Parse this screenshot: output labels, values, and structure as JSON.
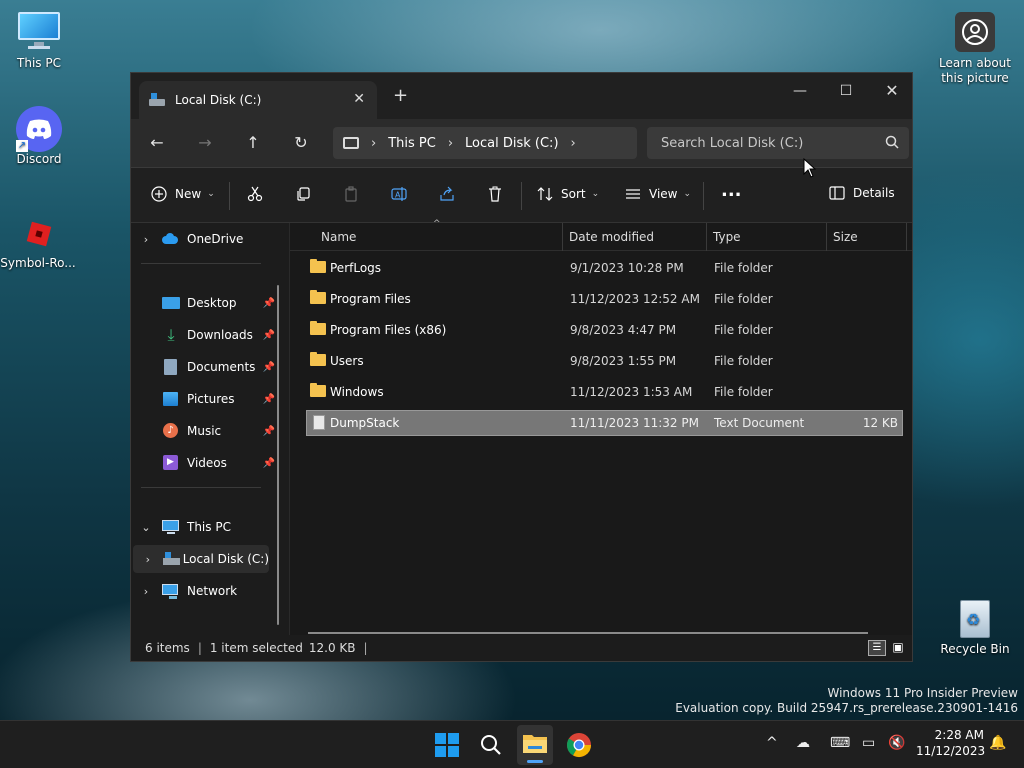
{
  "desktop": {
    "icons": [
      {
        "label": "This PC"
      },
      {
        "label": "Discord"
      },
      {
        "label": "Symbol-Ro..."
      },
      {
        "label": "Learn about this picture"
      },
      {
        "label": "Recycle Bin"
      }
    ],
    "watermark_line1": "Windows 11 Pro Insider Preview",
    "watermark_line2": "Evaluation copy. Build 25947.rs_prerelease.230901-1416"
  },
  "window": {
    "tab_title": "Local Disk (C:)",
    "new_tab": "+",
    "address": {
      "segments": [
        "This PC",
        "Local Disk (C:)"
      ]
    },
    "search_placeholder": "Search Local Disk (C:)",
    "toolbar": {
      "new_label": "New",
      "sort_label": "Sort",
      "view_label": "View",
      "more_label": "...",
      "details_label": "Details"
    },
    "nav": {
      "onedrive": "OneDrive",
      "quick": [
        {
          "label": "Desktop"
        },
        {
          "label": "Downloads"
        },
        {
          "label": "Documents"
        },
        {
          "label": "Pictures"
        },
        {
          "label": "Music"
        },
        {
          "label": "Videos"
        }
      ],
      "this_pc": "This PC",
      "local_disk": "Local Disk (C:)",
      "network": "Network"
    },
    "columns": {
      "name": "Name",
      "date": "Date modified",
      "type": "Type",
      "size": "Size"
    },
    "files": [
      {
        "name": "PerfLogs",
        "date": "9/1/2023 10:28 PM",
        "type": "File folder",
        "size": ""
      },
      {
        "name": "Program Files",
        "date": "11/12/2023 12:52 AM",
        "type": "File folder",
        "size": ""
      },
      {
        "name": "Program Files (x86)",
        "date": "9/8/2023 4:47 PM",
        "type": "File folder",
        "size": ""
      },
      {
        "name": "Users",
        "date": "9/8/2023 1:55 PM",
        "type": "File folder",
        "size": ""
      },
      {
        "name": "Windows",
        "date": "11/12/2023 1:53 AM",
        "type": "File folder",
        "size": ""
      },
      {
        "name": "DumpStack",
        "date": "11/11/2023 11:32 PM",
        "type": "Text Document",
        "size": "12 KB"
      }
    ],
    "status": {
      "items": "6 items",
      "selected": "1 item selected",
      "size": "12.0 KB"
    }
  },
  "taskbar": {
    "time": "2:28 AM",
    "date": "11/12/2023"
  },
  "colors": {
    "accent": "#0078d4",
    "folder": "#f4c24f",
    "selection": "#777777"
  }
}
